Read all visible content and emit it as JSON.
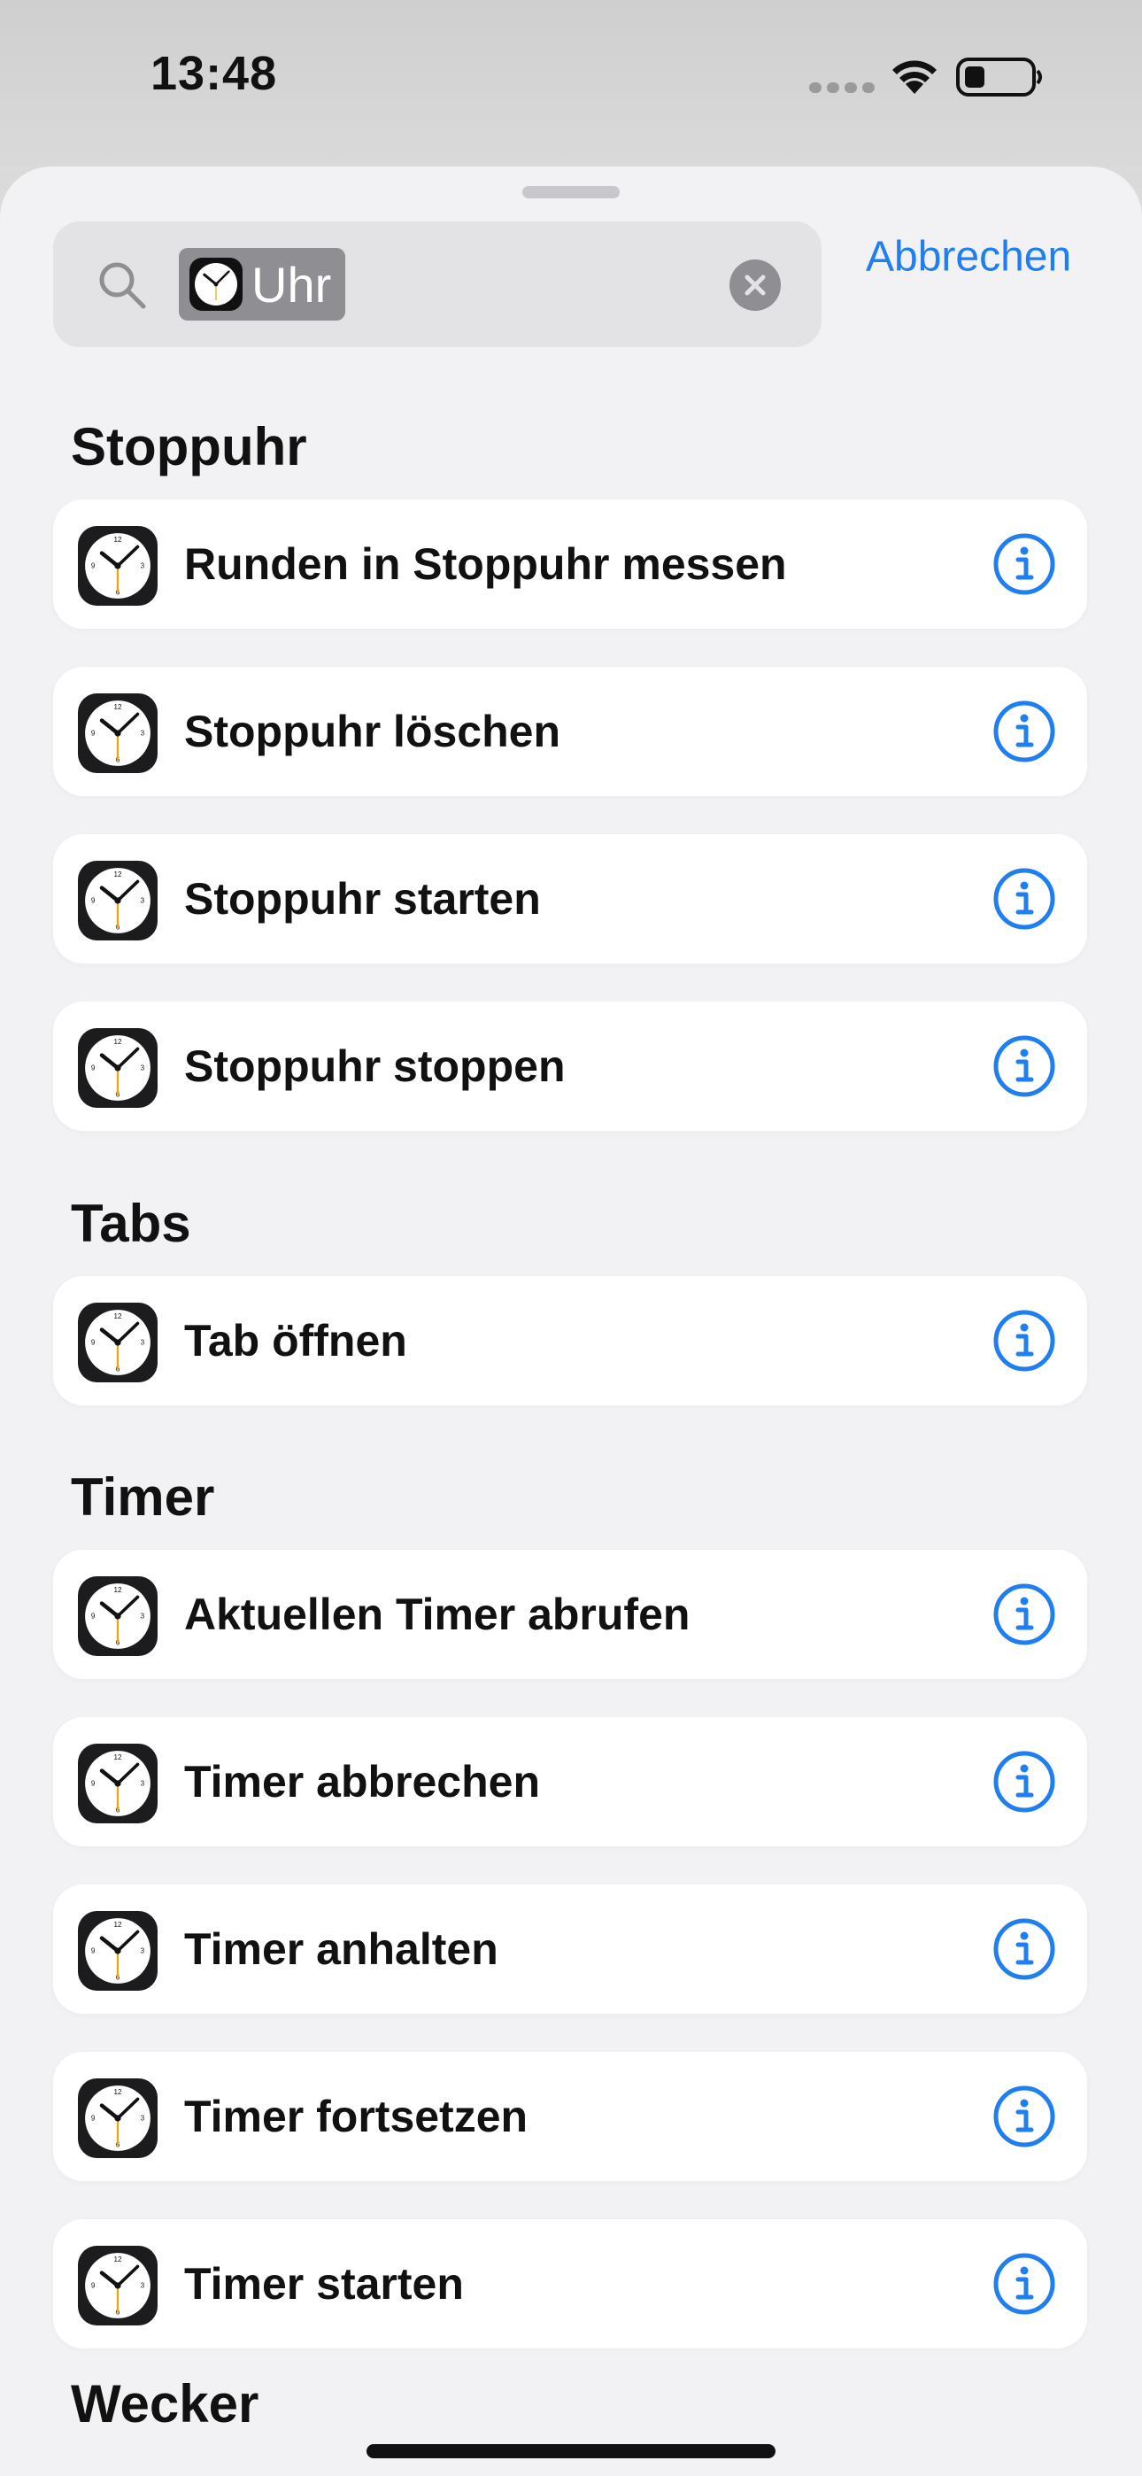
{
  "status_bar": {
    "time": "13:48",
    "icons": [
      "cellular-signal-icon",
      "wifi-icon",
      "battery-icon"
    ]
  },
  "search": {
    "token_label": "Uhr",
    "token_icon": "clock-app-icon",
    "cancel_label": "Abbrechen"
  },
  "sections": [
    {
      "title": "Stoppuhr",
      "items": [
        {
          "label": "Runden in Stoppuhr messen"
        },
        {
          "label": "Stoppuhr löschen"
        },
        {
          "label": "Stoppuhr starten"
        },
        {
          "label": "Stoppuhr stoppen"
        }
      ]
    },
    {
      "title": "Tabs",
      "items": [
        {
          "label": "Tab öffnen"
        }
      ]
    },
    {
      "title": "Timer",
      "items": [
        {
          "label": "Aktuellen Timer abrufen"
        },
        {
          "label": "Timer abbrechen"
        },
        {
          "label": "Timer anhalten"
        },
        {
          "label": "Timer fortsetzen"
        },
        {
          "label": "Timer starten"
        }
      ]
    },
    {
      "title": "Wecker",
      "items": []
    }
  ],
  "colors": {
    "accent": "#1f7ef0",
    "card": "#ffffff",
    "sheet": "#f2f2f4",
    "text": "#111111"
  }
}
